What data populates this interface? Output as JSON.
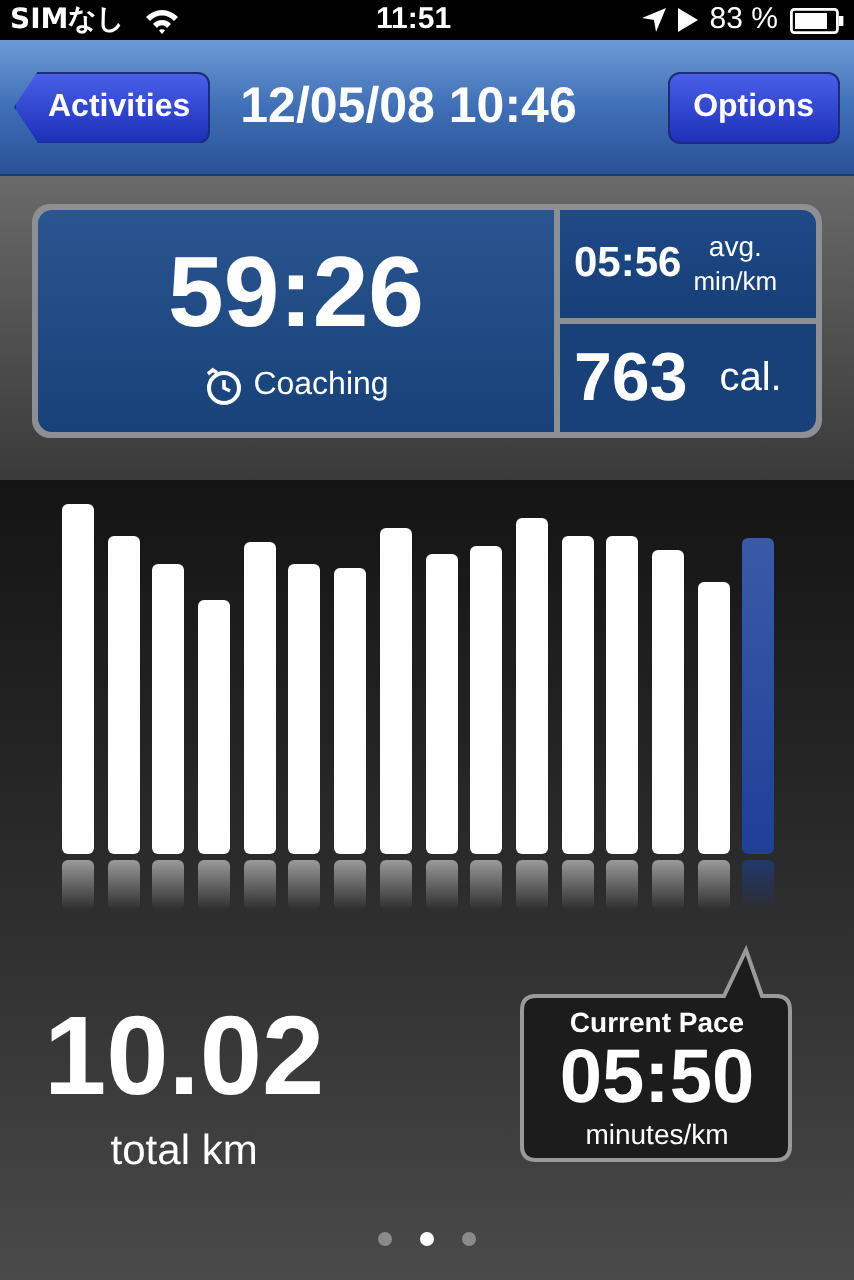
{
  "status_bar": {
    "carrier": "SIMなし",
    "time": "11:51",
    "battery": "83 %"
  },
  "nav_bar": {
    "back_button": "Activities",
    "title": "12/05/08 10:46",
    "options_button": "Options"
  },
  "summary": {
    "duration": "59:26",
    "mode": "Coaching",
    "avg_pace": "05:56",
    "avg_pace_label": "avg.",
    "avg_pace_unit": "min/km",
    "calories": "763",
    "calories_unit": "cal."
  },
  "splits": [
    {
      "selected": false
    },
    {
      "selected": false
    },
    {
      "selected": false
    },
    {
      "selected": false
    },
    {
      "selected": false
    },
    {
      "selected": false
    },
    {
      "selected": false
    },
    {
      "selected": false
    },
    {
      "selected": false
    },
    {
      "selected": false
    },
    {
      "selected": false
    },
    {
      "selected": false
    },
    {
      "selected": false
    },
    {
      "selected": false
    },
    {
      "selected": false
    },
    {
      "selected": true
    }
  ],
  "distance": {
    "value": "10.02",
    "unit": "total km"
  },
  "current_pace": {
    "title": "Current Pace",
    "value": "05:50",
    "unit": "minutes/km"
  },
  "page_dots": [
    {
      "selected": false
    },
    {
      "selected": true
    },
    {
      "selected": false
    }
  ]
}
